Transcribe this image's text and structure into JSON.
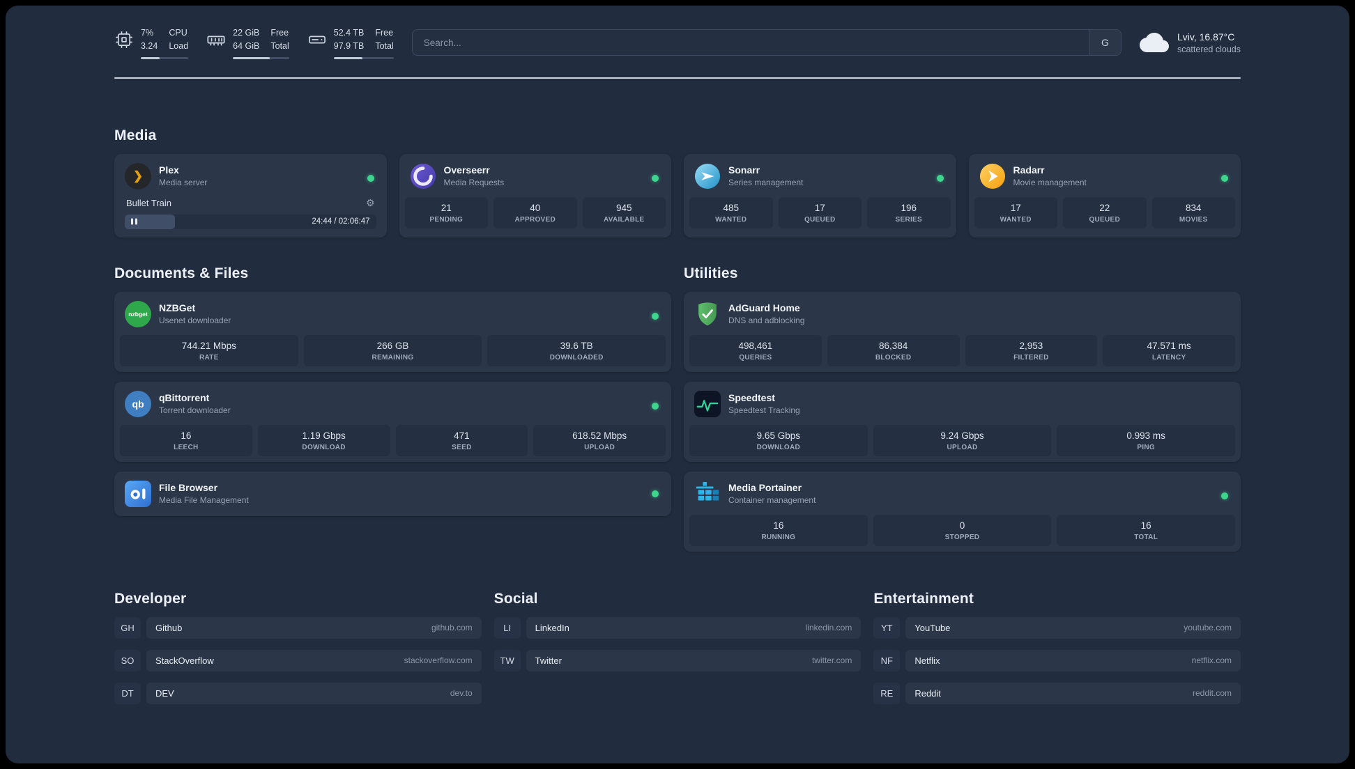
{
  "topbar": {
    "cpu": {
      "value_top": "7%",
      "value_bottom": "3.24",
      "label_top": "CPU",
      "label_bottom": "Load",
      "bar_percent": 40
    },
    "memory": {
      "value_top": "22 GiB",
      "value_bottom": "64 GiB",
      "label_top": "Free",
      "label_bottom": "Total",
      "bar_percent": 66
    },
    "disk": {
      "value_top": "52.4 TB",
      "value_bottom": "97.9 TB",
      "label_top": "Free",
      "label_bottom": "Total",
      "bar_percent": 48
    },
    "search": {
      "placeholder": "Search...",
      "button_label": "G"
    },
    "weather": {
      "location": "Lviv, 16.87°C",
      "condition": "scattered clouds"
    }
  },
  "media": {
    "heading": "Media",
    "plex": {
      "name": "Plex",
      "desc": "Media server",
      "now_playing": {
        "title": "Bullet Train",
        "time": "24:44 / 02:06:47",
        "progress_percent": 20
      }
    },
    "overseerr": {
      "name": "Overseerr",
      "desc": "Media Requests",
      "stats": [
        {
          "value": "21",
          "label": "PENDING"
        },
        {
          "value": "40",
          "label": "APPROVED"
        },
        {
          "value": "945",
          "label": "AVAILABLE"
        }
      ]
    },
    "sonarr": {
      "name": "Sonarr",
      "desc": "Series management",
      "stats": [
        {
          "value": "485",
          "label": "WANTED"
        },
        {
          "value": "17",
          "label": "QUEUED"
        },
        {
          "value": "196",
          "label": "SERIES"
        }
      ]
    },
    "radarr": {
      "name": "Radarr",
      "desc": "Movie management",
      "stats": [
        {
          "value": "17",
          "label": "WANTED"
        },
        {
          "value": "22",
          "label": "QUEUED"
        },
        {
          "value": "834",
          "label": "MOVIES"
        }
      ]
    }
  },
  "documents": {
    "heading": "Documents & Files",
    "nzbget": {
      "name": "NZBGet",
      "desc": "Usenet downloader",
      "stats": [
        {
          "value": "744.21 Mbps",
          "label": "RATE"
        },
        {
          "value": "266 GB",
          "label": "REMAINING"
        },
        {
          "value": "39.6 TB",
          "label": "DOWNLOADED"
        }
      ]
    },
    "qbittorrent": {
      "name": "qBittorrent",
      "desc": "Torrent downloader",
      "stats": [
        {
          "value": "16",
          "label": "LEECH"
        },
        {
          "value": "1.19 Gbps",
          "label": "DOWNLOAD"
        },
        {
          "value": "471",
          "label": "SEED"
        },
        {
          "value": "618.52 Mbps",
          "label": "UPLOAD"
        }
      ]
    },
    "filebrowser": {
      "name": "File Browser",
      "desc": "Media File Management"
    }
  },
  "utilities": {
    "heading": "Utilities",
    "adguard": {
      "name": "AdGuard Home",
      "desc": "DNS and adblocking",
      "stats": [
        {
          "value": "498,461",
          "label": "QUERIES"
        },
        {
          "value": "86,384",
          "label": "BLOCKED"
        },
        {
          "value": "2,953",
          "label": "FILTERED"
        },
        {
          "value": "47.571 ms",
          "label": "LATENCY"
        }
      ]
    },
    "speedtest": {
      "name": "Speedtest",
      "desc": "Speedtest Tracking",
      "stats": [
        {
          "value": "9.65 Gbps",
          "label": "DOWNLOAD"
        },
        {
          "value": "9.24 Gbps",
          "label": "UPLOAD"
        },
        {
          "value": "0.993 ms",
          "label": "PING"
        }
      ]
    },
    "portainer": {
      "name": "Media Portainer",
      "desc": "Container management",
      "stats": [
        {
          "value": "16",
          "label": "RUNNING"
        },
        {
          "value": "0",
          "label": "STOPPED"
        },
        {
          "value": "16",
          "label": "TOTAL"
        }
      ]
    }
  },
  "bookmarks": {
    "developer": {
      "heading": "Developer",
      "items": [
        {
          "abbr": "GH",
          "name": "Github",
          "url": "github.com"
        },
        {
          "abbr": "SO",
          "name": "StackOverflow",
          "url": "stackoverflow.com"
        },
        {
          "abbr": "DT",
          "name": "DEV",
          "url": "dev.to"
        }
      ]
    },
    "social": {
      "heading": "Social",
      "items": [
        {
          "abbr": "LI",
          "name": "LinkedIn",
          "url": "linkedin.com"
        },
        {
          "abbr": "TW",
          "name": "Twitter",
          "url": "twitter.com"
        }
      ]
    },
    "entertainment": {
      "heading": "Entertainment",
      "items": [
        {
          "abbr": "YT",
          "name": "YouTube",
          "url": "youtube.com"
        },
        {
          "abbr": "NF",
          "name": "Netflix",
          "url": "netflix.com"
        },
        {
          "abbr": "RE",
          "name": "Reddit",
          "url": "reddit.com"
        }
      ]
    }
  },
  "icons": {
    "gear": "⚙",
    "plex_chevron": "❯",
    "nzbget_text": "nzbget",
    "qbittorrent_text": "qb"
  },
  "colors": {
    "status_online": "#3dd68c",
    "plex_amber": "#e5a00d",
    "background": "#212c3e",
    "card": "#2b3649"
  }
}
